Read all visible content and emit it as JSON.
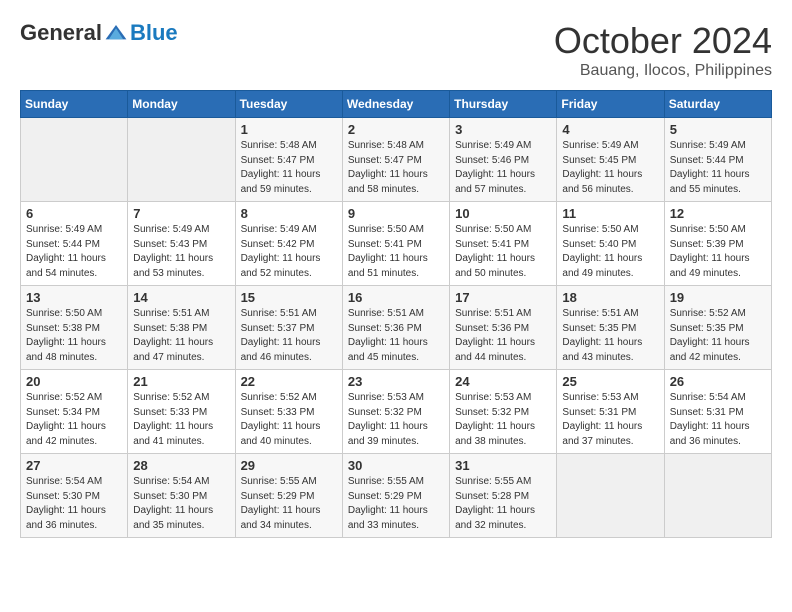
{
  "logo": {
    "general": "General",
    "blue": "Blue"
  },
  "title": {
    "month": "October 2024",
    "location": "Bauang, Ilocos, Philippines"
  },
  "headers": [
    "Sunday",
    "Monday",
    "Tuesday",
    "Wednesday",
    "Thursday",
    "Friday",
    "Saturday"
  ],
  "weeks": [
    [
      {
        "day": "",
        "info": ""
      },
      {
        "day": "",
        "info": ""
      },
      {
        "day": "1",
        "info": "Sunrise: 5:48 AM\nSunset: 5:47 PM\nDaylight: 11 hours and 59 minutes."
      },
      {
        "day": "2",
        "info": "Sunrise: 5:48 AM\nSunset: 5:47 PM\nDaylight: 11 hours and 58 minutes."
      },
      {
        "day": "3",
        "info": "Sunrise: 5:49 AM\nSunset: 5:46 PM\nDaylight: 11 hours and 57 minutes."
      },
      {
        "day": "4",
        "info": "Sunrise: 5:49 AM\nSunset: 5:45 PM\nDaylight: 11 hours and 56 minutes."
      },
      {
        "day": "5",
        "info": "Sunrise: 5:49 AM\nSunset: 5:44 PM\nDaylight: 11 hours and 55 minutes."
      }
    ],
    [
      {
        "day": "6",
        "info": "Sunrise: 5:49 AM\nSunset: 5:44 PM\nDaylight: 11 hours and 54 minutes."
      },
      {
        "day": "7",
        "info": "Sunrise: 5:49 AM\nSunset: 5:43 PM\nDaylight: 11 hours and 53 minutes."
      },
      {
        "day": "8",
        "info": "Sunrise: 5:49 AM\nSunset: 5:42 PM\nDaylight: 11 hours and 52 minutes."
      },
      {
        "day": "9",
        "info": "Sunrise: 5:50 AM\nSunset: 5:41 PM\nDaylight: 11 hours and 51 minutes."
      },
      {
        "day": "10",
        "info": "Sunrise: 5:50 AM\nSunset: 5:41 PM\nDaylight: 11 hours and 50 minutes."
      },
      {
        "day": "11",
        "info": "Sunrise: 5:50 AM\nSunset: 5:40 PM\nDaylight: 11 hours and 49 minutes."
      },
      {
        "day": "12",
        "info": "Sunrise: 5:50 AM\nSunset: 5:39 PM\nDaylight: 11 hours and 49 minutes."
      }
    ],
    [
      {
        "day": "13",
        "info": "Sunrise: 5:50 AM\nSunset: 5:38 PM\nDaylight: 11 hours and 48 minutes."
      },
      {
        "day": "14",
        "info": "Sunrise: 5:51 AM\nSunset: 5:38 PM\nDaylight: 11 hours and 47 minutes."
      },
      {
        "day": "15",
        "info": "Sunrise: 5:51 AM\nSunset: 5:37 PM\nDaylight: 11 hours and 46 minutes."
      },
      {
        "day": "16",
        "info": "Sunrise: 5:51 AM\nSunset: 5:36 PM\nDaylight: 11 hours and 45 minutes."
      },
      {
        "day": "17",
        "info": "Sunrise: 5:51 AM\nSunset: 5:36 PM\nDaylight: 11 hours and 44 minutes."
      },
      {
        "day": "18",
        "info": "Sunrise: 5:51 AM\nSunset: 5:35 PM\nDaylight: 11 hours and 43 minutes."
      },
      {
        "day": "19",
        "info": "Sunrise: 5:52 AM\nSunset: 5:35 PM\nDaylight: 11 hours and 42 minutes."
      }
    ],
    [
      {
        "day": "20",
        "info": "Sunrise: 5:52 AM\nSunset: 5:34 PM\nDaylight: 11 hours and 42 minutes."
      },
      {
        "day": "21",
        "info": "Sunrise: 5:52 AM\nSunset: 5:33 PM\nDaylight: 11 hours and 41 minutes."
      },
      {
        "day": "22",
        "info": "Sunrise: 5:52 AM\nSunset: 5:33 PM\nDaylight: 11 hours and 40 minutes."
      },
      {
        "day": "23",
        "info": "Sunrise: 5:53 AM\nSunset: 5:32 PM\nDaylight: 11 hours and 39 minutes."
      },
      {
        "day": "24",
        "info": "Sunrise: 5:53 AM\nSunset: 5:32 PM\nDaylight: 11 hours and 38 minutes."
      },
      {
        "day": "25",
        "info": "Sunrise: 5:53 AM\nSunset: 5:31 PM\nDaylight: 11 hours and 37 minutes."
      },
      {
        "day": "26",
        "info": "Sunrise: 5:54 AM\nSunset: 5:31 PM\nDaylight: 11 hours and 36 minutes."
      }
    ],
    [
      {
        "day": "27",
        "info": "Sunrise: 5:54 AM\nSunset: 5:30 PM\nDaylight: 11 hours and 36 minutes."
      },
      {
        "day": "28",
        "info": "Sunrise: 5:54 AM\nSunset: 5:30 PM\nDaylight: 11 hours and 35 minutes."
      },
      {
        "day": "29",
        "info": "Sunrise: 5:55 AM\nSunset: 5:29 PM\nDaylight: 11 hours and 34 minutes."
      },
      {
        "day": "30",
        "info": "Sunrise: 5:55 AM\nSunset: 5:29 PM\nDaylight: 11 hours and 33 minutes."
      },
      {
        "day": "31",
        "info": "Sunrise: 5:55 AM\nSunset: 5:28 PM\nDaylight: 11 hours and 32 minutes."
      },
      {
        "day": "",
        "info": ""
      },
      {
        "day": "",
        "info": ""
      }
    ]
  ]
}
